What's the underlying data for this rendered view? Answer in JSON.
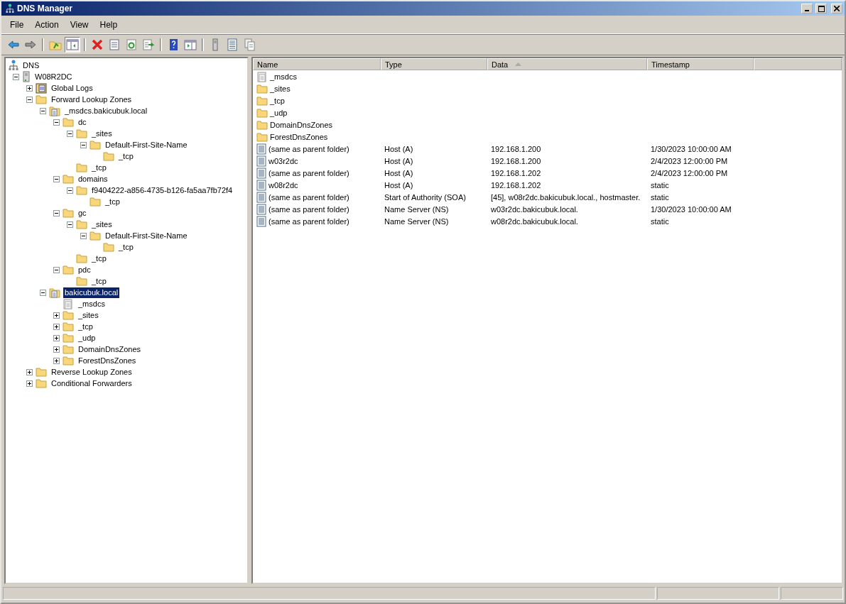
{
  "window": {
    "title": "DNS Manager"
  },
  "menu": [
    "File",
    "Action",
    "View",
    "Help"
  ],
  "toolbar": [
    {
      "kind": "back",
      "pressed": false
    },
    {
      "kind": "forward",
      "pressed": false
    },
    {
      "kind": "separator"
    },
    {
      "kind": "up",
      "pressed": false
    },
    {
      "kind": "console-tree",
      "pressed": true
    },
    {
      "kind": "separator"
    },
    {
      "kind": "delete",
      "pressed": false
    },
    {
      "kind": "properties",
      "pressed": false
    },
    {
      "kind": "refresh",
      "pressed": false
    },
    {
      "kind": "export",
      "pressed": false
    },
    {
      "kind": "separator"
    },
    {
      "kind": "help",
      "pressed": false
    },
    {
      "kind": "action-pane",
      "pressed": false
    },
    {
      "kind": "separator"
    },
    {
      "kind": "server",
      "pressed": false
    },
    {
      "kind": "list",
      "pressed": false
    },
    {
      "kind": "copy",
      "pressed": false
    }
  ],
  "tree": [
    {
      "label": "DNS",
      "kind": "dns",
      "selected": false,
      "children": [
        {
          "label": "W08R2DC",
          "kind": "server",
          "expanded": true,
          "selected": false,
          "children": [
            {
              "label": "Global Logs",
              "kind": "logs",
              "expanded": false,
              "selected": false
            },
            {
              "label": "Forward Lookup Zones",
              "kind": "folder",
              "expanded": true,
              "selected": false,
              "children": [
                {
                  "label": "_msdcs.bakicubuk.local",
                  "kind": "zone",
                  "expanded": true,
                  "selected": false,
                  "children": [
                    {
                      "label": "dc",
                      "kind": "folder",
                      "expanded": true,
                      "selected": false,
                      "children": [
                        {
                          "label": "_sites",
                          "kind": "folder",
                          "expanded": true,
                          "selected": false,
                          "children": [
                            {
                              "label": "Default-First-Site-Name",
                              "kind": "folder",
                              "expanded": true,
                              "selected": false,
                              "children": [
                                {
                                  "label": "_tcp",
                                  "kind": "folder",
                                  "selected": false
                                }
                              ]
                            }
                          ]
                        },
                        {
                          "label": "_tcp",
                          "kind": "folder",
                          "selected": false
                        }
                      ]
                    },
                    {
                      "label": "domains",
                      "kind": "folder",
                      "expanded": true,
                      "selected": false,
                      "children": [
                        {
                          "label": "f9404222-a856-4735-b126-fa5aa7fb72f4",
                          "kind": "folder",
                          "expanded": true,
                          "selected": false,
                          "children": [
                            {
                              "label": "_tcp",
                              "kind": "folder",
                              "selected": false
                            }
                          ]
                        }
                      ]
                    },
                    {
                      "label": "gc",
                      "kind": "folder",
                      "expanded": true,
                      "selected": false,
                      "children": [
                        {
                          "label": "_sites",
                          "kind": "folder",
                          "expanded": true,
                          "selected": false,
                          "children": [
                            {
                              "label": "Default-First-Site-Name",
                              "kind": "folder",
                              "expanded": true,
                              "selected": false,
                              "children": [
                                {
                                  "label": "_tcp",
                                  "kind": "folder",
                                  "selected": false
                                }
                              ]
                            }
                          ]
                        },
                        {
                          "label": "_tcp",
                          "kind": "folder",
                          "selected": false
                        }
                      ]
                    },
                    {
                      "label": "pdc",
                      "kind": "folder",
                      "expanded": true,
                      "selected": false,
                      "children": [
                        {
                          "label": "_tcp",
                          "kind": "folder",
                          "selected": false
                        }
                      ]
                    }
                  ]
                },
                {
                  "label": "bakicubuk.local",
                  "kind": "zone",
                  "expanded": true,
                  "selected": true,
                  "children": [
                    {
                      "label": "_msdcs",
                      "kind": "zone-grey",
                      "selected": false
                    },
                    {
                      "label": "_sites",
                      "kind": "folder",
                      "expanded": false,
                      "selected": false
                    },
                    {
                      "label": "_tcp",
                      "kind": "folder",
                      "expanded": false,
                      "selected": false
                    },
                    {
                      "label": "_udp",
                      "kind": "folder",
                      "expanded": false,
                      "selected": false
                    },
                    {
                      "label": "DomainDnsZones",
                      "kind": "folder",
                      "expanded": false,
                      "selected": false
                    },
                    {
                      "label": "ForestDnsZones",
                      "kind": "folder",
                      "expanded": false,
                      "selected": false
                    }
                  ]
                }
              ]
            },
            {
              "label": "Reverse Lookup Zones",
              "kind": "folder",
              "expanded": false,
              "selected": false
            },
            {
              "label": "Conditional Forwarders",
              "kind": "folder",
              "expanded": false,
              "selected": false
            }
          ]
        }
      ]
    }
  ],
  "list": {
    "columns": [
      {
        "label": "Name",
        "sorted": false
      },
      {
        "label": "Type",
        "sorted": false
      },
      {
        "label": "Data",
        "sorted": true
      },
      {
        "label": "Timestamp",
        "sorted": false
      }
    ],
    "rows": [
      {
        "kind": "zone-grey",
        "name": "_msdcs"
      },
      {
        "kind": "folder",
        "name": "_sites"
      },
      {
        "kind": "folder",
        "name": "_tcp"
      },
      {
        "kind": "folder",
        "name": "_udp"
      },
      {
        "kind": "folder",
        "name": "DomainDnsZones"
      },
      {
        "kind": "folder",
        "name": "ForestDnsZones"
      },
      {
        "kind": "record",
        "name": "(same as parent folder)",
        "type": "Host (A)",
        "data": "192.168.1.200",
        "timestamp": "1/30/2023 10:00:00 AM"
      },
      {
        "kind": "record",
        "name": "w03r2dc",
        "type": "Host (A)",
        "data": "192.168.1.200",
        "timestamp": "2/4/2023 12:00:00 PM"
      },
      {
        "kind": "record",
        "name": "(same as parent folder)",
        "type": "Host (A)",
        "data": "192.168.1.202",
        "timestamp": "2/4/2023 12:00:00 PM"
      },
      {
        "kind": "record",
        "name": "w08r2dc",
        "type": "Host (A)",
        "data": "192.168.1.202",
        "timestamp": "static"
      },
      {
        "kind": "record",
        "name": "(same as parent folder)",
        "type": "Start of Authority (SOA)",
        "data": "[45], w08r2dc.bakicubuk.local., hostmaster.",
        "timestamp": "static"
      },
      {
        "kind": "record",
        "name": "(same as parent folder)",
        "type": "Name Server (NS)",
        "data": "w03r2dc.bakicubuk.local.",
        "timestamp": "1/30/2023 10:00:00 AM"
      },
      {
        "kind": "record",
        "name": "(same as parent folder)",
        "type": "Name Server (NS)",
        "data": "w08r2dc.bakicubuk.local.",
        "timestamp": "static"
      }
    ]
  }
}
